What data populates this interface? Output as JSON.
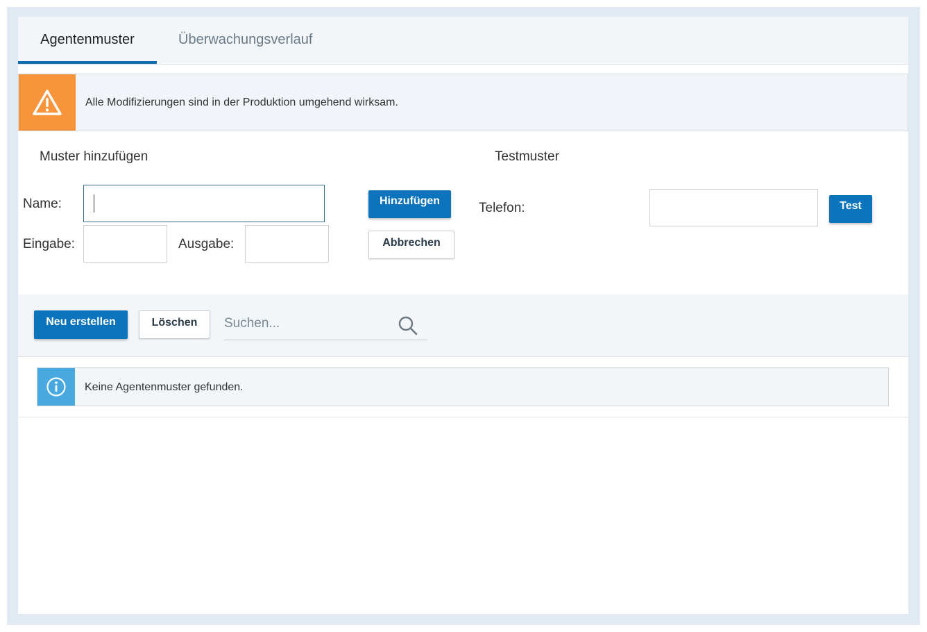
{
  "tabs": [
    {
      "label": "Agentenmuster",
      "active": true
    },
    {
      "label": "Überwachungsverlauf",
      "active": false
    }
  ],
  "warning": {
    "icon": "warning-triangle-icon",
    "text": "Alle Modifizierungen sind in der Produktion umgehend wirksam.",
    "color": "#f8943a"
  },
  "add_pattern": {
    "title": "Muster hinzufügen",
    "name_label": "Name:",
    "name_value": "",
    "input_label": "Eingabe:",
    "input_value": "",
    "output_label": "Ausgabe:",
    "output_value": "",
    "add_button": "Hinzufügen",
    "cancel_button": "Abbrechen"
  },
  "test_pattern": {
    "title": "Testmuster",
    "phone_label": "Telefon:",
    "phone_value": "",
    "test_button": "Test"
  },
  "toolbar": {
    "new_button": "Neu erstellen",
    "delete_button": "Löschen",
    "search_placeholder": "Suchen...",
    "search_icon": "search-icon"
  },
  "info": {
    "icon": "info-icon",
    "text": "Keine Agentenmuster gefunden.",
    "color": "#47a9df"
  },
  "colors": {
    "accent": "#0b74bd",
    "background": "#e1e9f3"
  }
}
